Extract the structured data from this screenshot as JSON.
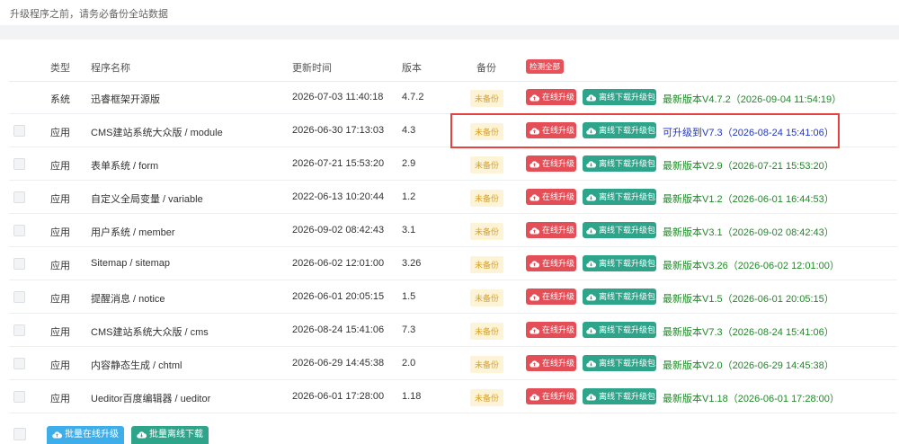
{
  "notice": "升级程序之前，请务必备份全站数据",
  "table": {
    "headers": {
      "type": "类型",
      "name": "程序名称",
      "time": "更新时间",
      "version": "版本",
      "backup": "备份",
      "check_all": "检测全部"
    },
    "actions": {
      "online_upgrade": "在线升级",
      "offline_download": "离线下载升级包",
      "not_backed_up": "未备份"
    },
    "rows": [
      {
        "has_checkbox": false,
        "type": "系统",
        "name": "迅睿框架开源版",
        "time": "2026-07-03 11:40:18",
        "version": "4.7.2",
        "status": "最新版本V4.7.2（2026-09-04 11:54:19）",
        "status_kind": "ok"
      },
      {
        "has_checkbox": true,
        "type": "应用",
        "name": "CMS建站系统大众版 / module",
        "time": "2026-06-30 17:13:03",
        "version": "4.3",
        "status": "可升级到V7.3（2026-08-24 15:41:06）",
        "status_kind": "up"
      },
      {
        "has_checkbox": true,
        "type": "应用",
        "name": "表单系统 / form",
        "time": "2026-07-21 15:53:20",
        "version": "2.9",
        "status": "最新版本V2.9（2026-07-21 15:53:20）",
        "status_kind": "ok"
      },
      {
        "has_checkbox": true,
        "type": "应用",
        "name": "自定义全局变量 / variable",
        "time": "2022-06-13 10:20:44",
        "version": "1.2",
        "status": "最新版本V1.2（2026-06-01 16:44:53）",
        "status_kind": "ok"
      },
      {
        "has_checkbox": true,
        "type": "应用",
        "name": "用户系统 / member",
        "time": "2026-09-02 08:42:43",
        "version": "3.1",
        "status": "最新版本V3.1（2026-09-02 08:42:43）",
        "status_kind": "ok"
      },
      {
        "has_checkbox": true,
        "type": "应用",
        "name": "Sitemap / sitemap",
        "time": "2026-06-02 12:01:00",
        "version": "3.26",
        "status": "最新版本V3.26（2026-06-02 12:01:00）",
        "status_kind": "ok"
      },
      {
        "has_checkbox": true,
        "type": "应用",
        "name": "提醒消息 / notice",
        "time": "2026-06-01 20:05:15",
        "version": "1.5",
        "status": "最新版本V1.5（2026-06-01 20:05:15）",
        "status_kind": "ok"
      },
      {
        "has_checkbox": true,
        "type": "应用",
        "name": "CMS建站系统大众版 / cms",
        "time": "2026-08-24 15:41:06",
        "version": "7.3",
        "status": "最新版本V7.3（2026-08-24 15:41:06）",
        "status_kind": "ok"
      },
      {
        "has_checkbox": true,
        "type": "应用",
        "name": "内容静态生成 / chtml",
        "time": "2026-06-29 14:45:38",
        "version": "2.0",
        "status": "最新版本V2.0（2026-06-29 14:45:38）",
        "status_kind": "ok"
      },
      {
        "has_checkbox": true,
        "type": "应用",
        "name": "Ueditor百度编辑器 / ueditor",
        "time": "2026-06-01 17:28:00",
        "version": "1.18",
        "status": "最新版本V1.18（2026-06-01 17:28:00）",
        "status_kind": "ok"
      }
    ]
  },
  "bulk": {
    "online": "批量在线升级",
    "offline": "批量离线下载"
  },
  "colors": {
    "upgrade_red": "#e44f57",
    "download_green": "#2ea48b",
    "latest_green": "#1e8a26",
    "upgradable_blue": "#2036c8",
    "highlight_red": "#e64240"
  }
}
